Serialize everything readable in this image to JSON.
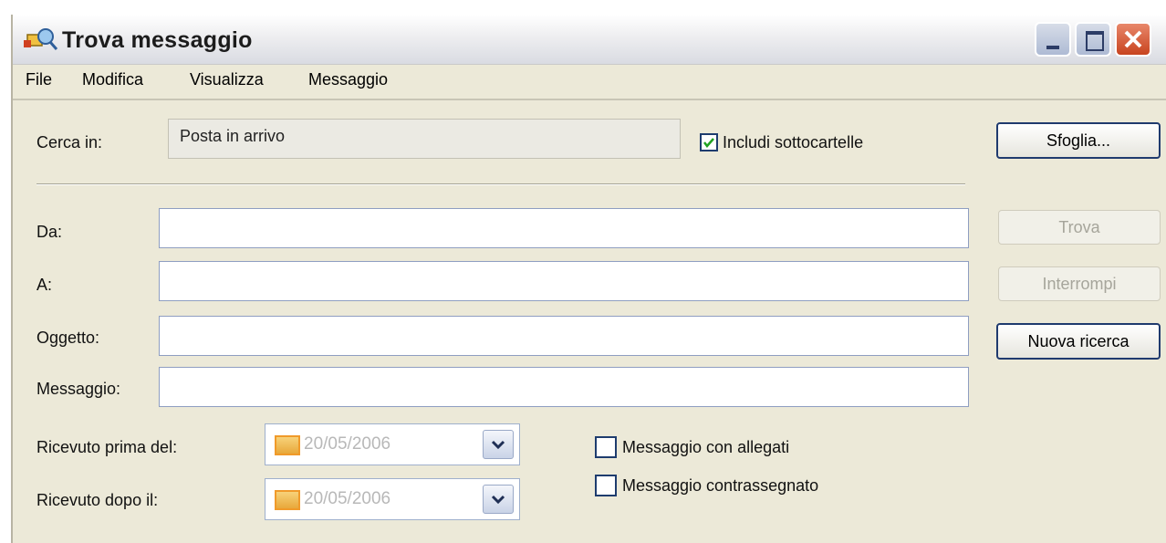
{
  "window": {
    "title": "Trova messaggio"
  },
  "menu": [
    "File",
    "Modifica",
    "Visualizza",
    "Messaggio"
  ],
  "search_in": {
    "label": "Cerca in:",
    "value": "Posta in arrivo",
    "include_subfolders_label": "Includi sottocartelle",
    "include_subfolders_checked": true,
    "browse_label": "Sfoglia..."
  },
  "fields": {
    "from_label": "Da:",
    "from_value": "",
    "to_label": "A:",
    "to_value": "",
    "subject_label": "Oggetto:",
    "subject_value": "",
    "message_label": "Messaggio:",
    "message_value": ""
  },
  "buttons": {
    "find": "Trova",
    "stop": "Interrompi",
    "new_search": "Nuova ricerca"
  },
  "dates": {
    "received_before_label": "Ricevuto prima del:",
    "received_before_value": "20/05/2006",
    "received_after_label": "Ricevuto dopo il:",
    "received_after_value": "20/05/2006"
  },
  "options": {
    "with_attachments_label": "Messaggio con allegati",
    "with_attachments_checked": false,
    "flagged_label": "Messaggio contrassegnato",
    "flagged_checked": false
  },
  "colors": {
    "window_bg": "#ece9d8",
    "close_button": "#c8441f",
    "checkbox_border": "#1e3c6e"
  }
}
